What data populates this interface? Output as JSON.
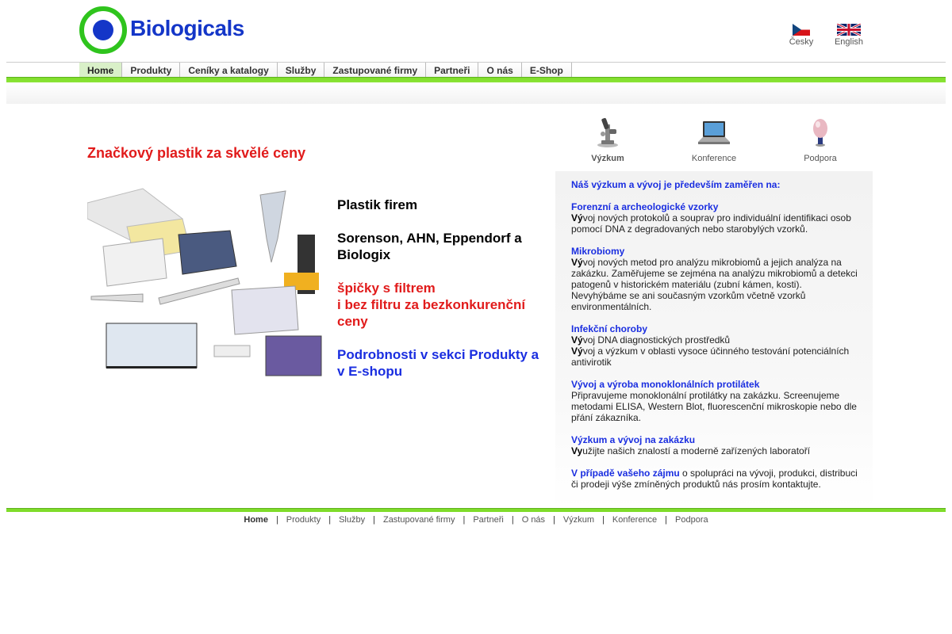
{
  "brand": {
    "logo_text": "Biologicals",
    "colors": {
      "ring": "#2fc41d",
      "dot": "#1436c8",
      "text": "#1436c8"
    }
  },
  "languages": [
    {
      "label": "Česky",
      "flag": "cz-flag-icon"
    },
    {
      "label": "English",
      "flag": "uk-flag-icon"
    }
  ],
  "nav": {
    "items": [
      "Home",
      "Produkty",
      "Ceníky a katalogy",
      "Služby",
      "Zastupované firmy",
      "Partneři",
      "O nás",
      "E-Shop"
    ],
    "active": "Home"
  },
  "top_icons": [
    {
      "label": "Výzkum",
      "icon": "microscope-icon"
    },
    {
      "label": "Konference",
      "icon": "laptop-icon"
    },
    {
      "label": "Podpora",
      "icon": "egg-icon"
    }
  ],
  "headline": "Značkový plastik za skvělé ceny",
  "promo": {
    "line1": "Plastik firem",
    "line2": "Sorenson, AHN, Eppendorf a Biologix",
    "line3a": "špičky s filtrem",
    "line3b": "i bez filtru za bezkonkurenční ceny",
    "line4": "Podrobnosti v sekci Produkty a v E-shopu"
  },
  "panel": {
    "intro": "Náš výzkum a vývoj je především zaměřen na:",
    "sections": [
      {
        "title": "Forenzní a archeologické vzorky",
        "lines": [
          {
            "prefix": "Vý",
            "text": "voj nových protokolů a souprav pro individuální identifikaci osob pomocí DNA z degradovaných nebo starobylých vzorků."
          }
        ]
      },
      {
        "title": "Mikrobiomy",
        "lines": [
          {
            "prefix": "Vý",
            "text": "voj nových metod pro analýzu mikrobiomů a jejich analýza na zakázku. Zaměřujeme se zejména na analýzu mikrobiomů a detekci patogenů v historickém materiálu (zubní kámen, kosti). Nevyhýbáme se ani současným vzorkům včetně vzorků environmentálních."
          }
        ]
      },
      {
        "title": "Infekční choroby",
        "lines": [
          {
            "prefix": "Vý",
            "text": "voj DNA diagnostických prostředků"
          },
          {
            "prefix": "Vý",
            "text": "voj a výzkum v oblasti vysoce účinného testování potenciálních antivirotik"
          }
        ]
      },
      {
        "title": "Vývoj a výroba monoklonálních protilátek",
        "lines": [
          {
            "prefix": "",
            "text": "Připravujeme monoklonální protilátky na zakázku. Screenujeme metodami ELISA, Western Blot, fluorescenční mikroskopie nebo dle přání zákazníka."
          }
        ]
      },
      {
        "title": "Výzkum a vývoj na zakázku",
        "lines": [
          {
            "prefix": "Vy",
            "text": "užijte našich znalostí a moderně zařízených laboratoří"
          }
        ]
      }
    ],
    "closing_link": "V případě vašeho zájmu",
    "closing_text": " o spolupráci na vývoji, produkci, distribuci či prodeji výše zmíněných produktů nás prosím kontaktujte."
  },
  "footer": {
    "items": [
      "Home",
      "Produkty",
      "Služby",
      "Zastupované firmy",
      "Partneři",
      "O nás",
      "Výzkum",
      "Konference",
      "Podpora"
    ],
    "active": "Home"
  }
}
